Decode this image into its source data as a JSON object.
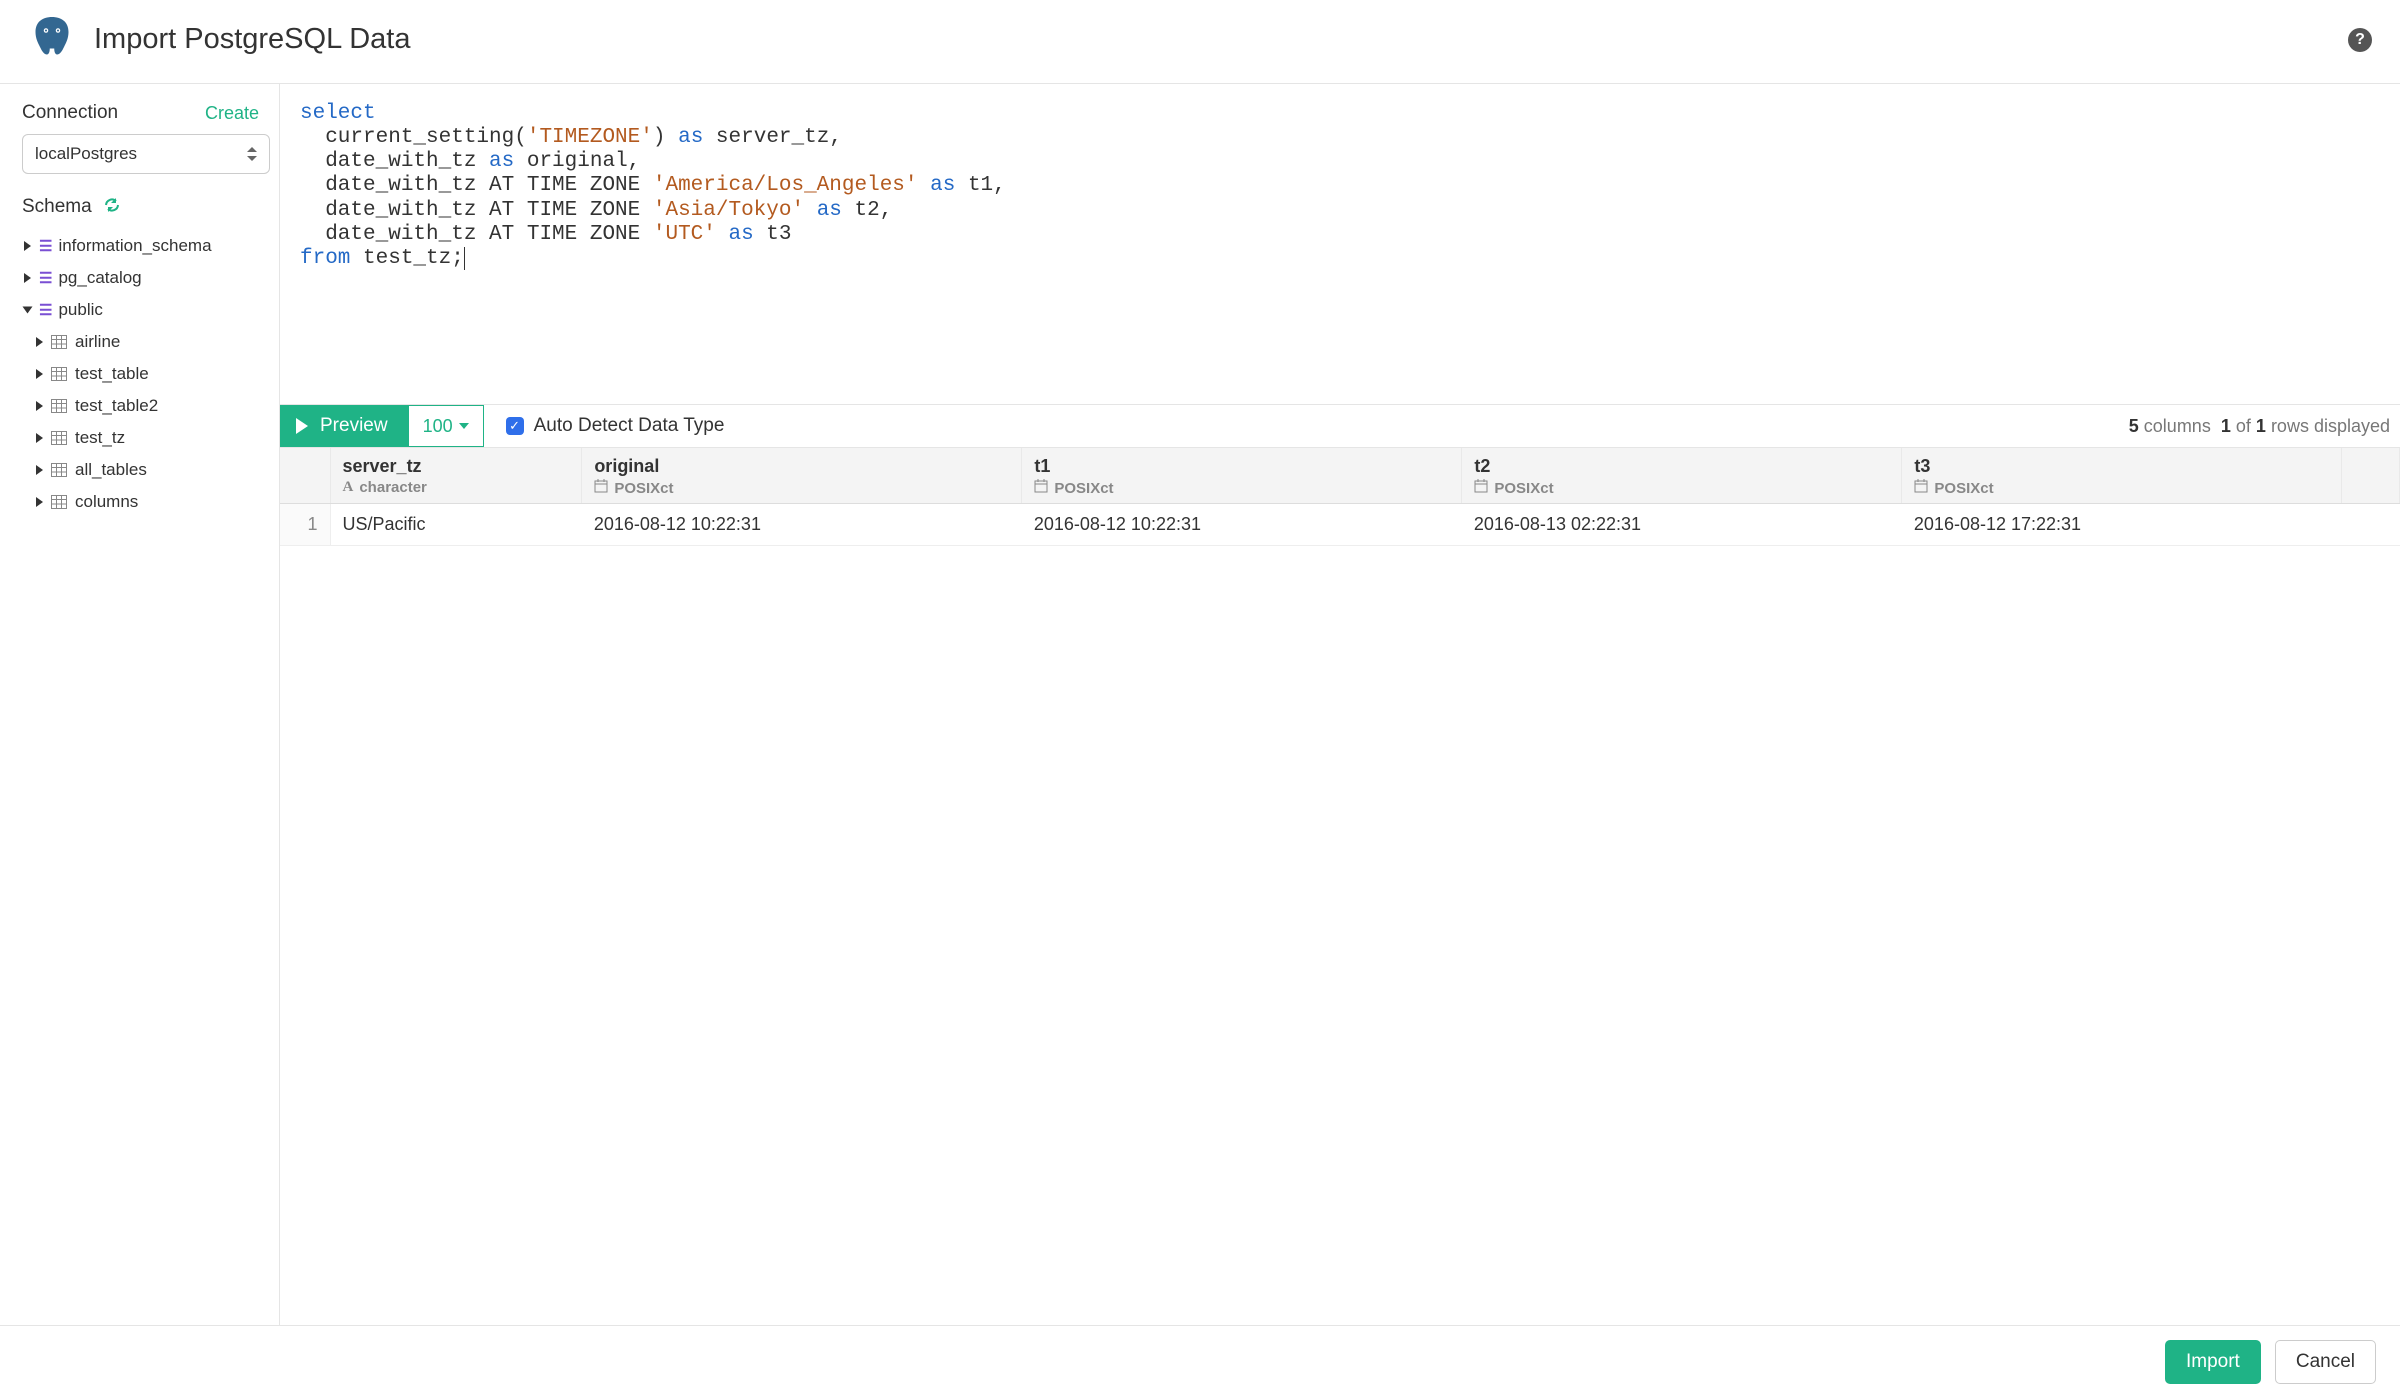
{
  "header": {
    "title": "Import PostgreSQL Data"
  },
  "sidebar": {
    "connection_label": "Connection",
    "create_label": "Create",
    "connection_value": "localPostgres",
    "schema_label": "Schema",
    "schemas": [
      {
        "name": "information_schema",
        "open": false
      },
      {
        "name": "pg_catalog",
        "open": false
      },
      {
        "name": "public",
        "open": true,
        "tables": [
          {
            "name": "airline"
          },
          {
            "name": "test_table"
          },
          {
            "name": "test_table2"
          },
          {
            "name": "test_tz"
          },
          {
            "name": "all_tables"
          },
          {
            "name": "columns"
          }
        ]
      }
    ]
  },
  "editor": {
    "tokens": [
      {
        "t": "select",
        "c": "kw"
      },
      {
        "t": "\n  current_setting("
      },
      {
        "t": "'TIMEZONE'",
        "c": "str"
      },
      {
        "t": ") "
      },
      {
        "t": "as",
        "c": "kw"
      },
      {
        "t": " server_tz,\n  date_with_tz "
      },
      {
        "t": "as",
        "c": "kw"
      },
      {
        "t": " original,\n  date_with_tz AT TIME ZONE "
      },
      {
        "t": "'America/Los_Angeles'",
        "c": "str"
      },
      {
        "t": " "
      },
      {
        "t": "as",
        "c": "kw"
      },
      {
        "t": " t1,\n  date_with_tz AT TIME ZONE "
      },
      {
        "t": "'Asia/Tokyo'",
        "c": "str"
      },
      {
        "t": " "
      },
      {
        "t": "as",
        "c": "kw"
      },
      {
        "t": " t2,\n  date_with_tz AT TIME ZONE "
      },
      {
        "t": "'UTC'",
        "c": "str"
      },
      {
        "t": " "
      },
      {
        "t": "as",
        "c": "kw"
      },
      {
        "t": " t3\n"
      },
      {
        "t": "from",
        "c": "kw"
      },
      {
        "t": " test_tz;"
      }
    ]
  },
  "preview": {
    "button_label": "Preview",
    "limit_label": "100",
    "auto_detect_label": "Auto Detect Data Type",
    "auto_detect_checked": true,
    "status_cols": "5",
    "status_cols_word": "columns",
    "status_row_shown": "1",
    "status_of": "of",
    "status_row_total": "1",
    "status_tail": "rows displayed"
  },
  "results": {
    "columns": [
      {
        "name": "server_tz",
        "type": "character",
        "icon": "A"
      },
      {
        "name": "original",
        "type": "POSIXct",
        "icon": "cal"
      },
      {
        "name": "t1",
        "type": "POSIXct",
        "icon": "cal"
      },
      {
        "name": "t2",
        "type": "POSIXct",
        "icon": "cal"
      },
      {
        "name": "t3",
        "type": "POSIXct",
        "icon": "cal"
      }
    ],
    "rows": [
      {
        "n": "1",
        "cells": [
          "US/Pacific",
          "2016-08-12 10:22:31",
          "2016-08-12 10:22:31",
          "2016-08-13 02:22:31",
          "2016-08-12 17:22:31"
        ]
      }
    ]
  },
  "footer": {
    "import_label": "Import",
    "cancel_label": "Cancel"
  }
}
